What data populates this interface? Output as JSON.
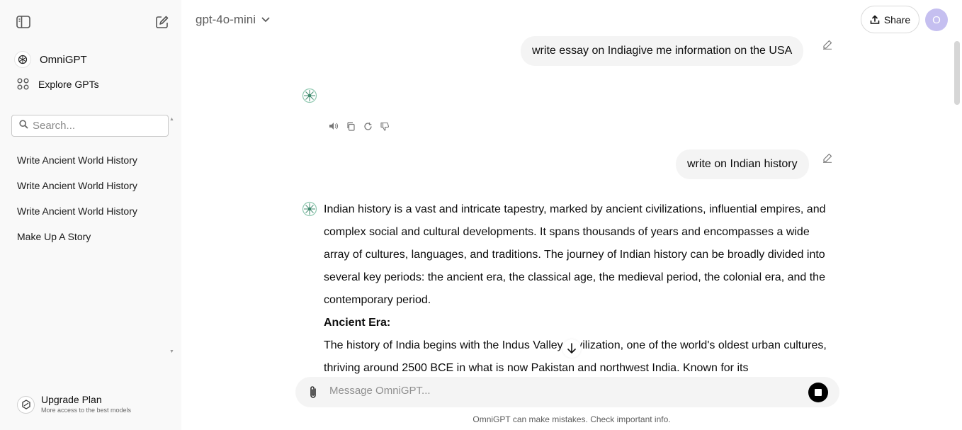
{
  "sidebar": {
    "brand_label": "OmniGPT",
    "explore_label": "Explore GPTs",
    "search_placeholder": "Search...",
    "history": [
      "Write Ancient World History",
      "Write Ancient World History",
      "Write Ancient World History",
      "Make Up A Story"
    ],
    "upgrade_title": "Upgrade Plan",
    "upgrade_subtitle": "More access to the best models"
  },
  "header": {
    "model_name": "gpt-4o-mini",
    "share_label": "Share",
    "avatar_initial": "O"
  },
  "chat": {
    "user_msg_1": "write essay on Indiagive me information on the USA",
    "user_msg_2": "write on Indian history",
    "response": {
      "paragraph_1": "Indian history is a vast and intricate tapestry, marked by ancient civilizations, influential empires, and complex social and cultural developments. It spans thousands of years and encompasses a wide array of cultures, languages, and traditions. The journey of Indian history can be broadly divided into several key periods: the ancient era, the classical age, the medieval period, the colonial era, and the contemporary period.",
      "heading_1": "Ancient Era:",
      "paragraph_2": "The history of India begins with the Indus Valley Civilization, one of the world's oldest urban cultures, thriving around 2500 BCE in what is now Pakistan and northwest India. Known for its"
    }
  },
  "composer": {
    "placeholder": "Message OmniGPT..."
  },
  "footer": {
    "disclaimer": "OmniGPT can make mistakes. Check important info."
  },
  "colors": {
    "sidebar_bg": "#f9f9f9",
    "bubble_bg": "#f4f4f4",
    "avatar_bg": "#c5bff0"
  }
}
